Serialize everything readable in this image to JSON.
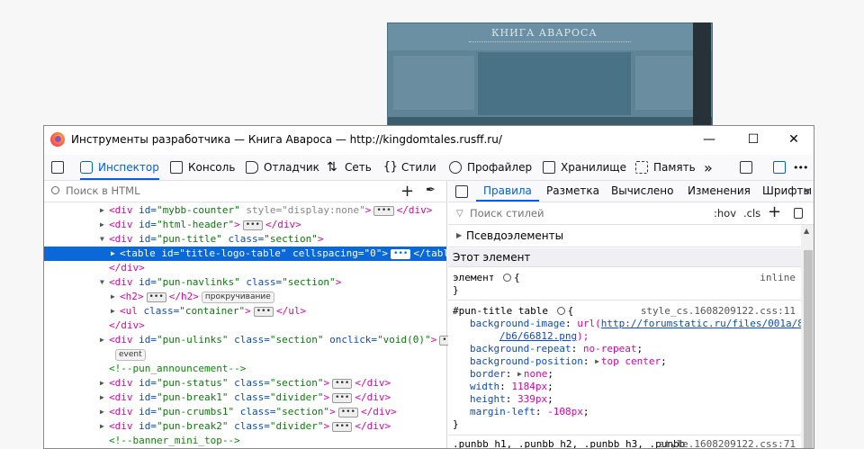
{
  "window": {
    "title": "Инструменты разработчика — Книга Авароса — http://kingdomtales.rusff.ru/",
    "minimize": "—",
    "maximize": "☐",
    "close": "✕"
  },
  "background_site": {
    "title": "КНИГА АВАРОСА"
  },
  "toolbar": {
    "inspector": "Инспектор",
    "console": "Консоль",
    "debugger": "Отладчик",
    "network": "Сеть",
    "styles": "Стили",
    "profiler": "Профайлер",
    "storage": "Хранилище",
    "memory": "Память",
    "more": "»",
    "overflow": "•••",
    "network_icon": "⇅",
    "styles_icon": "{}"
  },
  "html_panel": {
    "search_placeholder": "Поиск в HTML",
    "add": "+",
    "picker": "✒"
  },
  "tree": [
    {
      "code": [
        [
          "tag",
          "<div "
        ],
        [
          "attr",
          "id="
        ],
        [
          "val",
          "\"mybb-counter\""
        ],
        [
          "dimv",
          " style=\"display:none\""
        ],
        [
          "tag",
          ">"
        ],
        [
          "ell",
          "•••"
        ],
        [
          "tag",
          "</div>"
        ]
      ]
    },
    {
      "code": [
        [
          "tag",
          "<div "
        ],
        [
          "attr",
          "id="
        ],
        [
          "val",
          "\"html-header\""
        ],
        [
          "tag",
          ">"
        ],
        [
          "ell",
          "•••"
        ],
        [
          "tag",
          "</div>"
        ]
      ]
    },
    {
      "code": [
        [
          "tag",
          "<div "
        ],
        [
          "attr",
          "id="
        ],
        [
          "val",
          "\"pun-title\""
        ],
        [
          "attr",
          " class="
        ],
        [
          "val",
          "\"section\""
        ],
        [
          "tag",
          ">"
        ]
      ]
    },
    {
      "code": [
        [
          "tag",
          "<table "
        ],
        [
          "attr",
          "id="
        ],
        [
          "val",
          "\"title-logo-table\""
        ],
        [
          "attr",
          " cellspacing="
        ],
        [
          "val",
          "\"0\""
        ],
        [
          "tag",
          ">"
        ],
        [
          "ell",
          "•••"
        ],
        [
          "tag",
          "</table>"
        ]
      ]
    },
    {
      "code": [
        [
          "tag",
          "</div>"
        ]
      ]
    },
    {
      "code": [
        [
          "tag",
          "<div "
        ],
        [
          "attr",
          "id="
        ],
        [
          "val",
          "\"pun-navlinks\""
        ],
        [
          "attr",
          " class="
        ],
        [
          "val",
          "\"section\""
        ],
        [
          "tag",
          ">"
        ]
      ]
    },
    {
      "code": [
        [
          "tag",
          "<h2>"
        ],
        [
          "ell",
          "•••"
        ],
        [
          "tag",
          "</h2>"
        ],
        [
          "badge",
          "прокручивание"
        ]
      ]
    },
    {
      "code": [
        [
          "tag",
          "<ul "
        ],
        [
          "attr",
          "class="
        ],
        [
          "val",
          "\"container\""
        ],
        [
          "tag",
          ">"
        ],
        [
          "ell",
          "•••"
        ],
        [
          "tag",
          "</ul>"
        ]
      ]
    },
    {
      "code": [
        [
          "tag",
          "</div>"
        ]
      ]
    },
    {
      "code": [
        [
          "tag",
          "<div "
        ],
        [
          "attr",
          "id="
        ],
        [
          "val",
          "\"pun-ulinks\""
        ],
        [
          "attr",
          " class="
        ],
        [
          "val",
          "\"section\""
        ],
        [
          "attr",
          " onclick="
        ],
        [
          "val",
          "\"void(0)\""
        ],
        [
          "tag",
          ">"
        ],
        [
          "ell",
          "•••"
        ],
        [
          "tag",
          "</"
        ]
      ]
    },
    {
      "code": [
        [
          "badge",
          "event"
        ]
      ]
    },
    {
      "code": [
        [
          "cmt",
          "<!--pun_announcement-->"
        ]
      ]
    },
    {
      "code": [
        [
          "tag",
          "<div "
        ],
        [
          "attr",
          "id="
        ],
        [
          "val",
          "\"pun-status\""
        ],
        [
          "attr",
          " class="
        ],
        [
          "val",
          "\"section\""
        ],
        [
          "tag",
          ">"
        ],
        [
          "ell",
          "•••"
        ],
        [
          "tag",
          "</div>"
        ]
      ]
    },
    {
      "code": [
        [
          "tag",
          "<div "
        ],
        [
          "attr",
          "id="
        ],
        [
          "val",
          "\"pun-break1\""
        ],
        [
          "attr",
          " class="
        ],
        [
          "val",
          "\"divider\""
        ],
        [
          "tag",
          ">"
        ],
        [
          "ell",
          "•••"
        ],
        [
          "tag",
          "</div>"
        ]
      ]
    },
    {
      "code": [
        [
          "tag",
          "<div "
        ],
        [
          "attr",
          "id="
        ],
        [
          "val",
          "\"pun-crumbs1\""
        ],
        [
          "attr",
          " class="
        ],
        [
          "val",
          "\"section\""
        ],
        [
          "tag",
          ">"
        ],
        [
          "ell",
          "•••"
        ],
        [
          "tag",
          "</div>"
        ]
      ]
    },
    {
      "code": [
        [
          "tag",
          "<div "
        ],
        [
          "attr",
          "id="
        ],
        [
          "val",
          "\"pun-break2\""
        ],
        [
          "attr",
          " class="
        ],
        [
          "val",
          "\"divider\""
        ],
        [
          "tag",
          ">"
        ],
        [
          "ell",
          "•••"
        ],
        [
          "tag",
          "</div>"
        ]
      ]
    },
    {
      "code": [
        [
          "cmt",
          "<!--banner_mini_top-->"
        ]
      ]
    }
  ],
  "rules_panel": {
    "tabs": [
      "Правила",
      "Разметка",
      "Вычислено",
      "Изменения",
      "Шрифты"
    ],
    "filter_placeholder": "Поиск стилей",
    "hov": ":hov",
    "cls": ".cls",
    "add": "+",
    "pseudo": "Псевдоэлементы",
    "this_element": "Этот элемент",
    "element_selector": "элемент",
    "open_brace": "{",
    "close_brace": "}",
    "inline": "inline",
    "rule2_selector": "#pun-title table",
    "rule2_source": "style_cs.1608209122.css:11",
    "bg_image_name": "background-image",
    "bg_image_url_a": "http://forumstatic.ru/files/001a/84",
    "bg_image_url_b": "/b6/66812.png",
    "props": [
      {
        "name": "background-repeat",
        "value": "no-repeat"
      },
      {
        "name": "background-position",
        "value": "top center"
      },
      {
        "name": "border",
        "value": "none"
      },
      {
        "name": "width",
        "value": "1184px"
      },
      {
        "name": "height",
        "value": "339px"
      },
      {
        "name": "margin-left",
        "value": "-108px"
      }
    ],
    "rule3_selector": ".punbb h1, .punbb h2, .punbb h3, .punbb",
    "rule3_source": "style.1608209122.css:71"
  }
}
